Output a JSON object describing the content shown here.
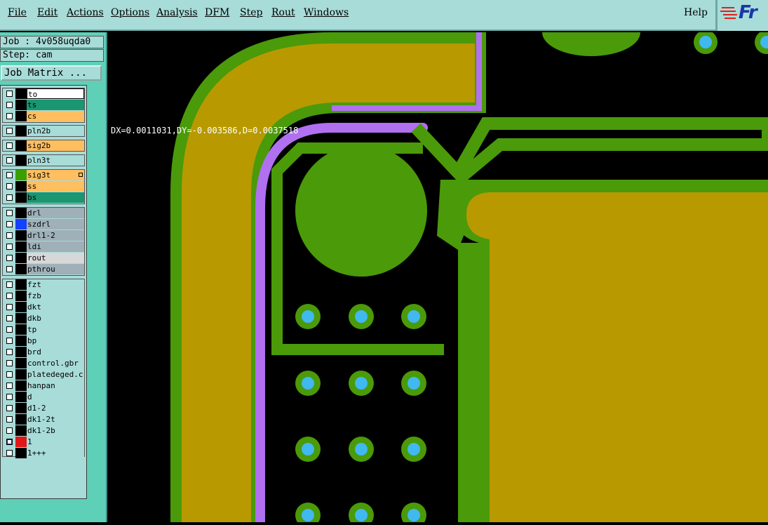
{
  "menu": {
    "file": "File",
    "edit": "Edit",
    "actions": "Actions",
    "options": "Options",
    "analysis": "Analysis",
    "dfm": "DFM",
    "step": "Step",
    "rout": "Rout",
    "windows": "Windows",
    "help": "Help"
  },
  "logo": {
    "text": "Fr"
  },
  "job": {
    "label": "Job : 4v058uqda0",
    "step": "Step: cam",
    "matrix_button": "Job Matrix ..."
  },
  "layers": [
    {
      "name": "to",
      "color": "#ffffff"
    },
    {
      "name": "ts",
      "color": "#1a9670"
    },
    {
      "name": "cs",
      "color": "#ffbf60"
    },
    {
      "name": "pln2b",
      "color": "#a8dcd8"
    },
    {
      "name": "sig2b",
      "color": "#ffbf60"
    },
    {
      "name": "pln3t",
      "color": "#a8dcd8"
    },
    {
      "name": "sig3t",
      "color": "#ffbf60"
    },
    {
      "name": "ss",
      "color": "#ffbf60"
    },
    {
      "name": "bs",
      "color": "#1a9670"
    },
    {
      "name": "drl",
      "color": "#9fb0b8"
    },
    {
      "name": "szdrl",
      "color": "#9fb0b8"
    },
    {
      "name": "drl1-2",
      "color": "#9fb0b8"
    },
    {
      "name": "ldi",
      "color": "#9fb0b8"
    },
    {
      "name": "rout",
      "color": "#d8d8d8"
    },
    {
      "name": "pthrou",
      "color": "#9fb0b8"
    },
    {
      "name": "fzt",
      "color": "#a8dcd8"
    },
    {
      "name": "fzb",
      "color": "#a8dcd8"
    },
    {
      "name": "dkt",
      "color": "#a8dcd8"
    },
    {
      "name": "dkb",
      "color": "#a8dcd8"
    },
    {
      "name": "tp",
      "color": "#a8dcd8"
    },
    {
      "name": "bp",
      "color": "#a8dcd8"
    },
    {
      "name": "brd",
      "color": "#a8dcd8"
    },
    {
      "name": "control.gbr",
      "color": "#a8dcd8"
    },
    {
      "name": "platedeged.c",
      "color": "#a8dcd8"
    },
    {
      "name": "hanpan",
      "color": "#a8dcd8"
    },
    {
      "name": "d",
      "color": "#a8dcd8"
    },
    {
      "name": "d1-2",
      "color": "#a8dcd8"
    },
    {
      "name": "dk1-2t",
      "color": "#a8dcd8"
    },
    {
      "name": "dk1-2b",
      "color": "#a8dcd8"
    },
    {
      "name": "1",
      "color": "#a8dcd8"
    },
    {
      "name": "1+++",
      "color": "#a8dcd8"
    }
  ],
  "measurement": {
    "text": "DX=0.0011031,DY=-0.003586,D=0.0037518"
  },
  "colors": {
    "board_green": "#4a9a0a",
    "copper": "#b89a00",
    "trace_purple": "#b070f0",
    "via_cyan": "#40b8f0",
    "background": "#000000",
    "panel_teal": "#5fd0b8"
  }
}
